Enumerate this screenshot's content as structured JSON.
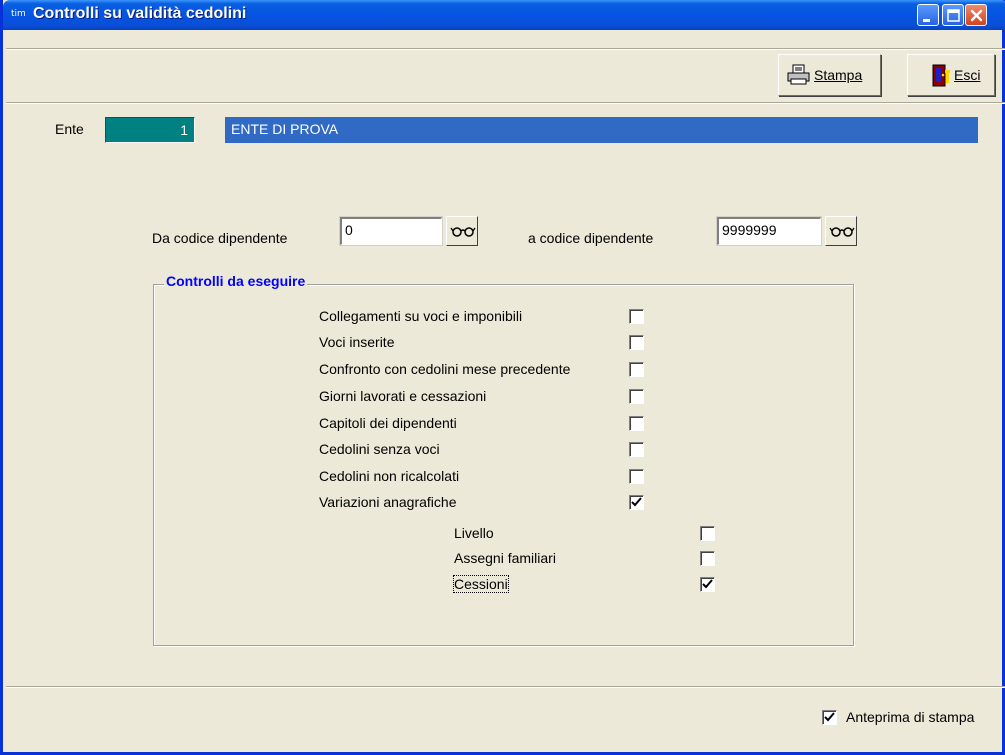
{
  "window": {
    "title": "Controlli su validità cedolini",
    "app_icon_text": "tim",
    "title_color": "#0554E3"
  },
  "toolbar": {
    "stampa_label": "Stampa",
    "esci_label": "Esci"
  },
  "ente": {
    "label": "Ente",
    "code": "1",
    "name": "ENTE DI PROVA"
  },
  "range": {
    "from_label": "Da codice dipendente",
    "from_value": "0",
    "to_label": "a codice dipendente",
    "to_value": "9999999"
  },
  "controls": {
    "group_title": "Controlli da eseguire",
    "items": [
      {
        "label": "Collegamenti su voci e imponibili",
        "checked": false
      },
      {
        "label": "Voci inserite",
        "checked": false
      },
      {
        "label": "Confronto con cedolini mese precedente",
        "checked": false
      },
      {
        "label": "Giorni lavorati e cessazioni",
        "checked": false
      },
      {
        "label": "Capitoli dei dipendenti",
        "checked": false
      },
      {
        "label": "Cedolini senza voci",
        "checked": false
      },
      {
        "label": "Cedolini non ricalcolati",
        "checked": false
      },
      {
        "label": "Variazioni anagrafiche",
        "checked": true
      }
    ],
    "subitems": [
      {
        "label": "Livello",
        "checked": false
      },
      {
        "label": "Assegni familiari",
        "checked": false
      },
      {
        "label": "Cessioni",
        "checked": true
      }
    ]
  },
  "footer": {
    "preview_label": "Anteprima di stampa",
    "preview_checked": true
  },
  "icons": {
    "app": "app-icon",
    "printer": "printer-icon",
    "exit": "exit-door-icon",
    "lookup": "glasses-icon"
  }
}
